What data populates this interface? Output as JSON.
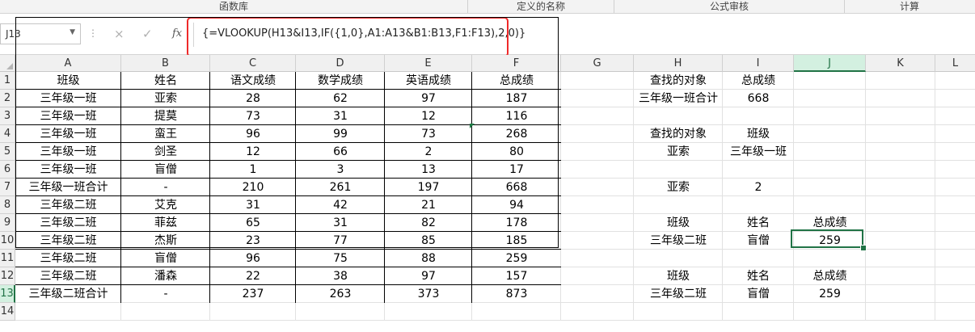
{
  "ribbon": {
    "groups": [
      {
        "label": "函数库"
      },
      {
        "label": "定义的名称"
      },
      {
        "label": "公式审核"
      },
      {
        "label": "计算"
      }
    ]
  },
  "formula_bar": {
    "name_box": "J13",
    "cancel_icon": "×",
    "enter_icon": "✓",
    "fx_label": "fx",
    "formula": "{=VLOOKUP(H13&I13,IF({1,0},A1:A13&B1:B13,F1:F13),2,0)}",
    "highlight_color": "#ef2a2a"
  },
  "sheet": {
    "columns": [
      "A",
      "B",
      "C",
      "D",
      "E",
      "F",
      "G",
      "H",
      "I",
      "J",
      "K",
      "L"
    ],
    "active_column": "J",
    "active_row": "13",
    "rows": [
      "1",
      "2",
      "3",
      "4",
      "5",
      "6",
      "7",
      "8",
      "9",
      "10",
      "11",
      "12",
      "13",
      "14"
    ],
    "accent_color": "#217346",
    "table": {
      "header": [
        "班级",
        "姓名",
        "语文成绩",
        "数学成绩",
        "英语成绩",
        "总成绩"
      ],
      "rows": [
        [
          "三年级一班",
          "亚索",
          "28",
          "62",
          "97",
          "187"
        ],
        [
          "三年级一班",
          "提莫",
          "73",
          "31",
          "12",
          "116"
        ],
        [
          "三年级一班",
          "蛮王",
          "96",
          "99",
          "73",
          "268"
        ],
        [
          "三年级一班",
          "剑圣",
          "12",
          "66",
          "2",
          "80"
        ],
        [
          "三年级一班",
          "盲僧",
          "1",
          "3",
          "13",
          "17"
        ],
        [
          "三年级一班合计",
          "-",
          "210",
          "261",
          "197",
          "668"
        ],
        [
          "三年级二班",
          "艾克",
          "31",
          "42",
          "21",
          "94"
        ],
        [
          "三年级二班",
          "菲兹",
          "65",
          "31",
          "82",
          "178"
        ],
        [
          "三年级二班",
          "杰斯",
          "23",
          "77",
          "85",
          "185"
        ],
        [
          "三年级二班",
          "盲僧",
          "96",
          "75",
          "88",
          "259"
        ],
        [
          "三年级二班",
          "潘森",
          "22",
          "38",
          "97",
          "157"
        ],
        [
          "三年级二班合计",
          "-",
          "237",
          "263",
          "373",
          "873"
        ]
      ]
    },
    "side": {
      "h1": "查找的对象",
      "i1": "总成绩",
      "h2": "三年级一班合计",
      "i2": "668",
      "h4": "查找的对象",
      "i4": "班级",
      "h5": "亚索",
      "i5": "三年级一班",
      "h7": "亚索",
      "i7": "2",
      "h9": "班级",
      "i9": "姓名",
      "j9": "总成绩",
      "h10": "三年级二班",
      "i10": "盲僧",
      "j10": "259",
      "h12": "班级",
      "i12": "姓名",
      "j12": "总成绩",
      "h13": "三年级二班",
      "i13": "盲僧",
      "j13": "259"
    }
  }
}
